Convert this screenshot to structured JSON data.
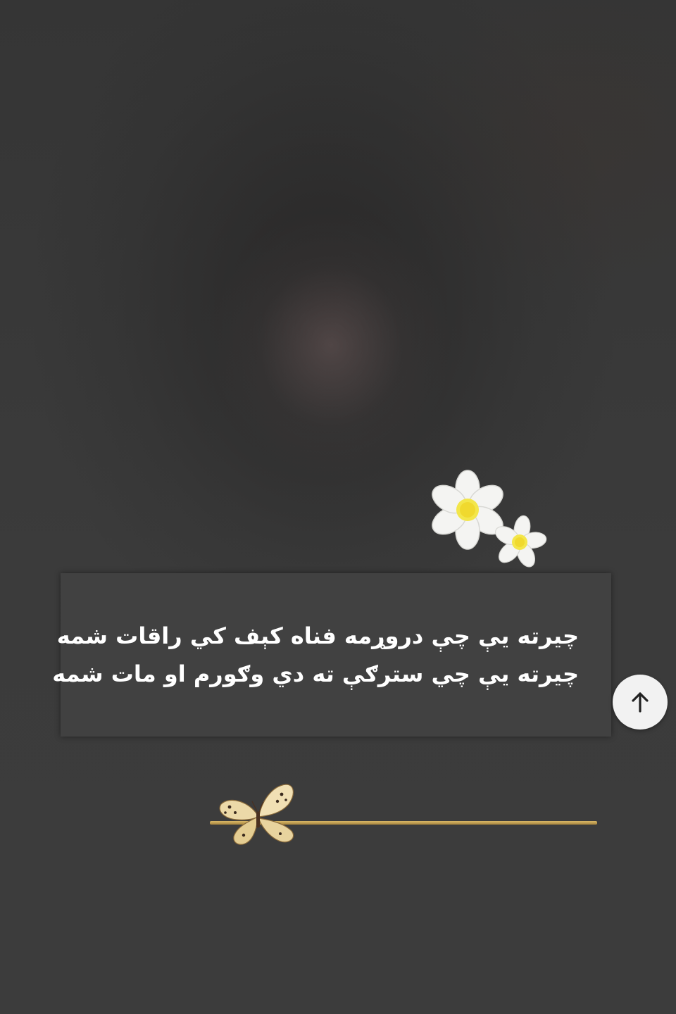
{
  "quote": {
    "line1": "چیرته یې چې دروړمه فناه کېف کي راقات شمه",
    "line2": "چیرته یې چي سترګې ته دي وګورم او مات شمه"
  },
  "scroll_top": {
    "icon": "arrow-up-icon",
    "aria_label": "↑"
  },
  "decor": {
    "flowers_icon": "daisy-flowers-icon",
    "butterfly_icon": "butterfly-icon",
    "divider_color": "#c9a653",
    "card_color": "#414141",
    "background_color": "#3a3a3a"
  }
}
